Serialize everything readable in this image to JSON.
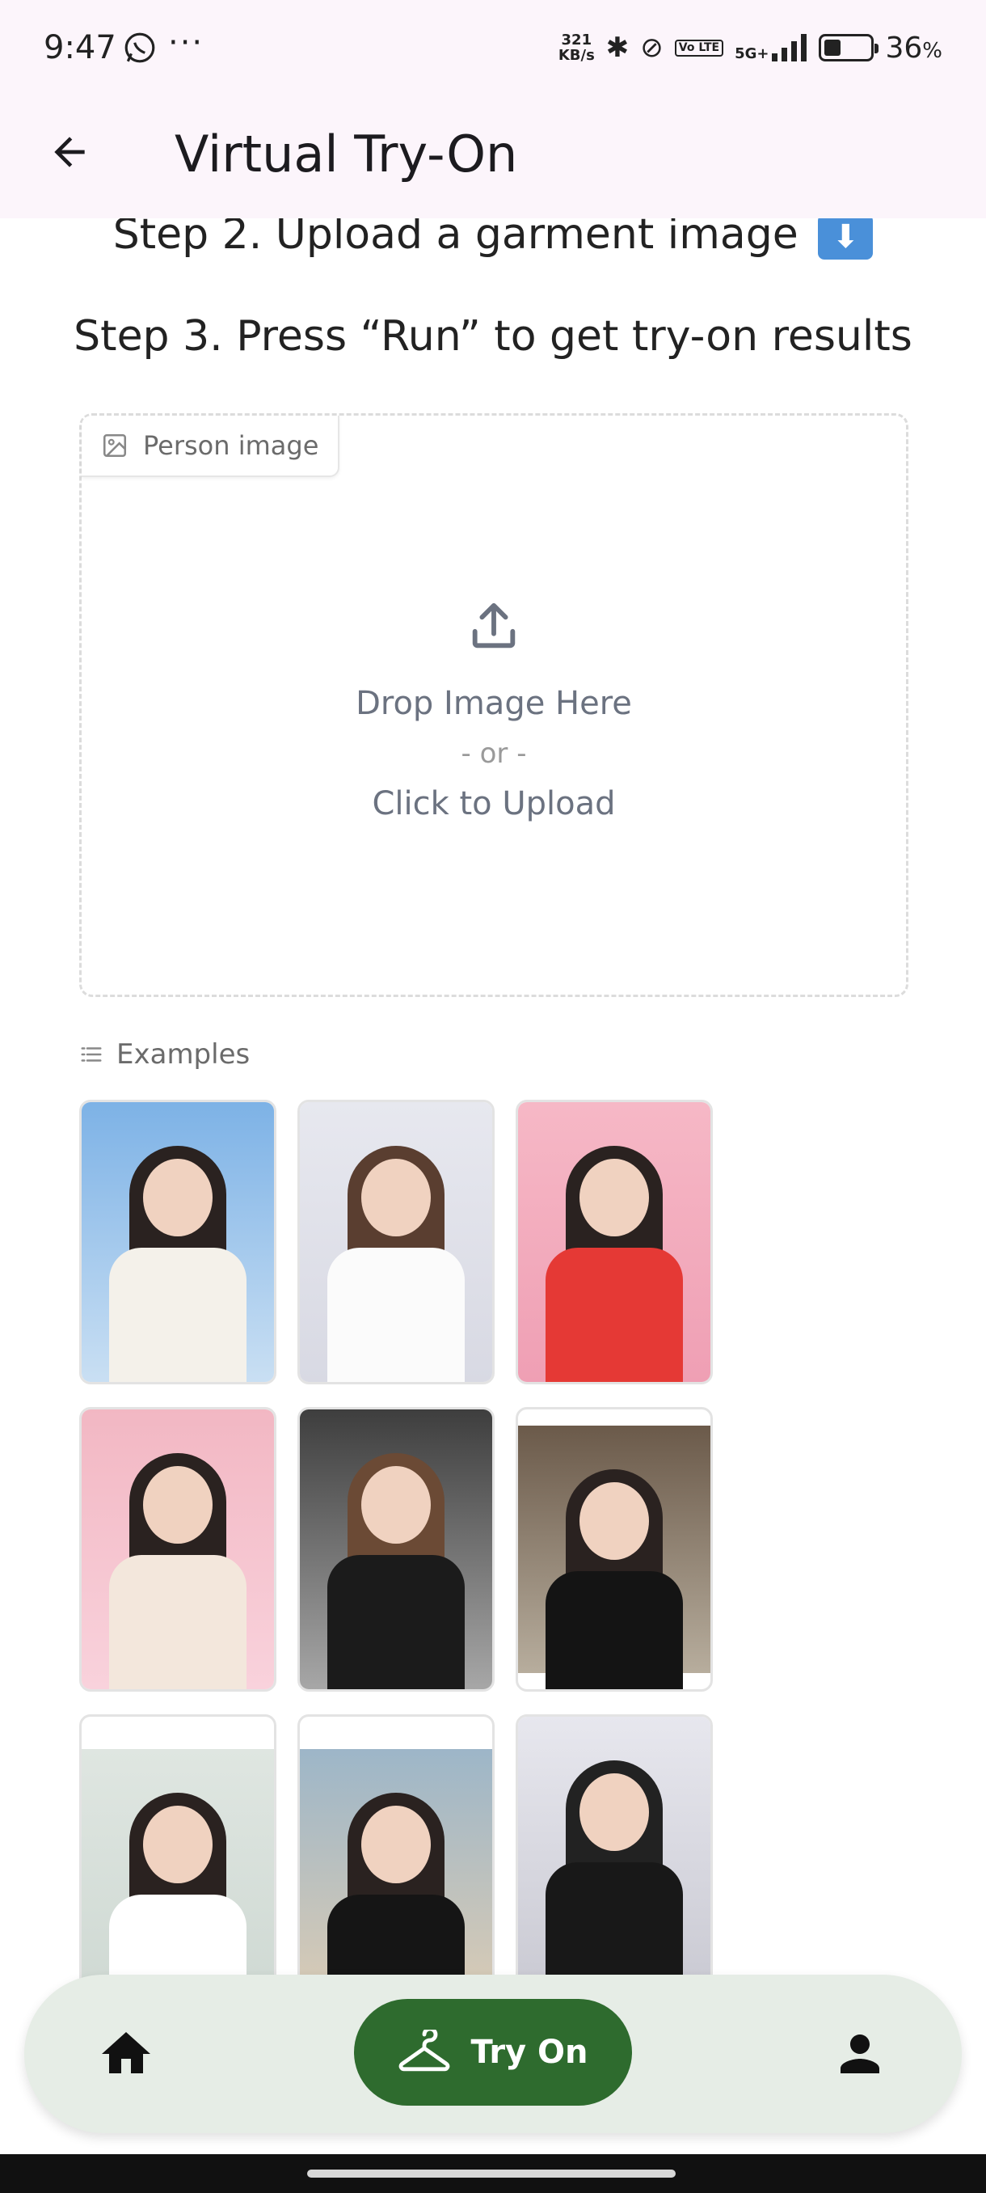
{
  "status_bar": {
    "time": "9:47",
    "net_speed_value": "321",
    "net_speed_unit": "KB/s",
    "network_lte": "Vo LTE",
    "network_5g": "5G+",
    "battery_percent": "36",
    "battery_unit": "%",
    "battery_level": 0.36
  },
  "appbar": {
    "title": "Virtual Try-On"
  },
  "steps": {
    "step2": "Step 2. Upload a garment image",
    "step2_emoji": "⬇",
    "step3": "Step 3. Press “Run” to get try-on results"
  },
  "upload": {
    "tab_label": "Person image",
    "drop_text": "Drop Image Here",
    "or_text": "- or -",
    "click_text": "Click to Upload"
  },
  "examples": {
    "label": "Examples",
    "items": [
      {
        "name": "example-1"
      },
      {
        "name": "example-2"
      },
      {
        "name": "example-3"
      },
      {
        "name": "example-4"
      },
      {
        "name": "example-5"
      },
      {
        "name": "example-6"
      },
      {
        "name": "example-7"
      },
      {
        "name": "example-8"
      },
      {
        "name": "example-9"
      }
    ]
  },
  "bottom_nav": {
    "tryon_label": "Try On",
    "accent_color": "#2e6b2e",
    "nav_bg": "#e6ede6"
  }
}
